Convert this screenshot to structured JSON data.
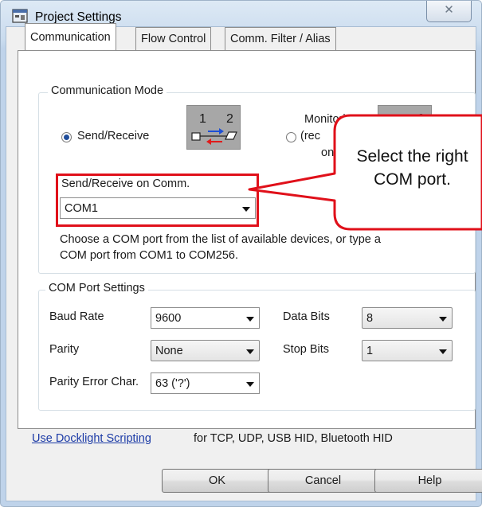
{
  "window": {
    "title": "Project Settings",
    "close_glyph": "✕"
  },
  "tabs": [
    {
      "label": "Communication",
      "active": true
    },
    {
      "label": "Flow Control",
      "active": false
    },
    {
      "label": "Comm. Filter / Alias",
      "active": false
    }
  ],
  "communication_mode": {
    "group_label": "Communication Mode",
    "send_receive_label": "Send/Receive",
    "send_receive_selected": true,
    "send_receive_diagram": {
      "num1": "1",
      "num2": "2"
    },
    "monitoring_label_line1": "Monitoring",
    "monitoring_label_line2": "(rec",
    "monitoring_label_line3": "only",
    "monitoring_selected": false,
    "monitoring_diagram": {
      "num2": "2"
    },
    "comm_label": "Send/Receive on Comm.",
    "comm_value": "COM1",
    "help_text_line1": "Choose a COM port from the list of available devices, or type a",
    "help_text_line2": "COM port from COM1 to COM256."
  },
  "com_port_settings": {
    "group_label": "COM Port Settings",
    "baud_rate_label": "Baud Rate",
    "baud_rate_value": "9600",
    "data_bits_label": "Data Bits",
    "data_bits_value": "8",
    "parity_label": "Parity",
    "parity_value": "None",
    "stop_bits_label": "Stop Bits",
    "stop_bits_value": "1",
    "parity_error_label": "Parity Error Char.",
    "parity_error_value": "63 ('?')"
  },
  "scripting": {
    "link_text": "Use Docklight Scripting",
    "suffix_text": "for TCP, UDP, USB HID, Bluetooth HID"
  },
  "buttons": {
    "ok": "OK",
    "cancel": "Cancel",
    "help": "Help"
  },
  "callout": {
    "line1": "Select the right",
    "line2": "COM port."
  },
  "colors": {
    "annotation_red": "#e0101a",
    "link_blue": "#1b3aa6",
    "radio_dot": "#1f4d9a"
  }
}
